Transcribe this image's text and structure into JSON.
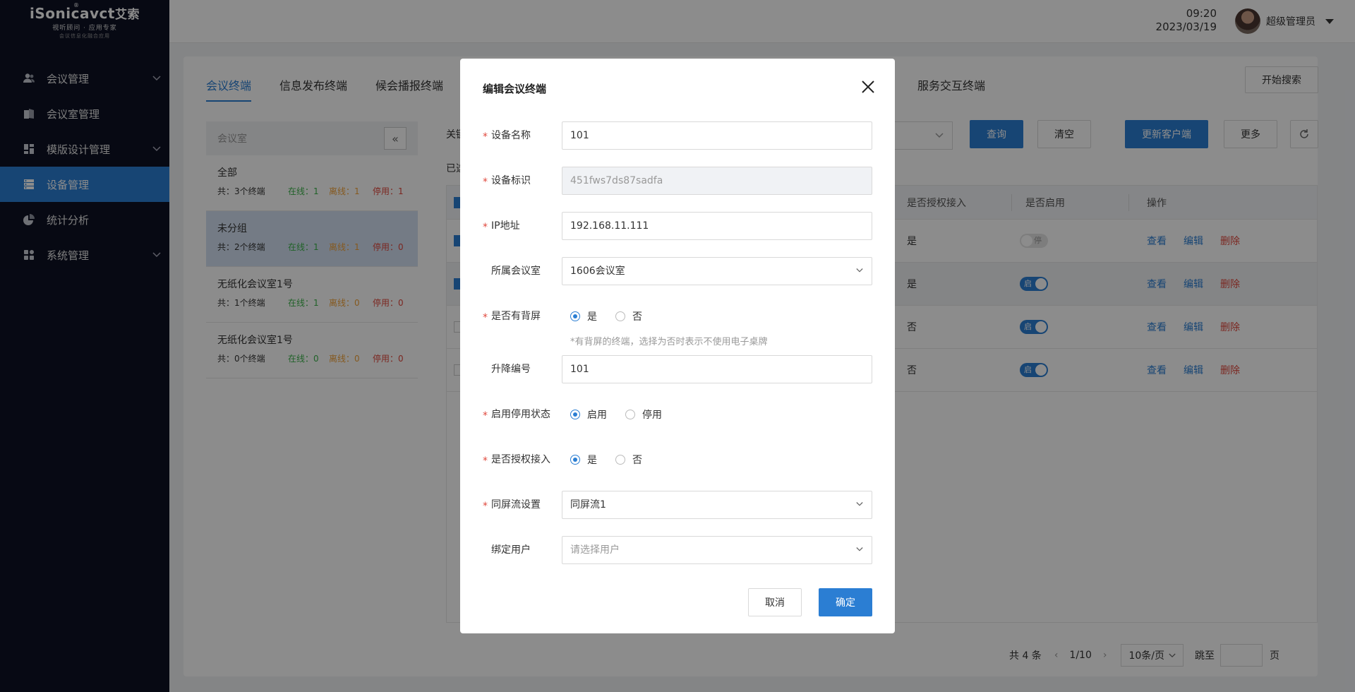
{
  "app": {
    "logo_text": "iSonicavct",
    "logo_cn": "艾索",
    "logo_tagline": "視听顾问 · 应用专家",
    "logo_subtag": "会议信息化融合应用",
    "logo_mark": "®"
  },
  "sidebar": {
    "items": [
      {
        "label": "会议管理",
        "icon": "users-icon",
        "has_arrow": true
      },
      {
        "label": "会议室管理",
        "icon": "door-icon",
        "has_arrow": false
      },
      {
        "label": "模版设计管理",
        "icon": "layout-icon",
        "has_arrow": true
      },
      {
        "label": "设备管理",
        "icon": "server-icon",
        "has_arrow": false,
        "active": true
      },
      {
        "label": "统计分析",
        "icon": "pie-chart-icon",
        "has_arrow": false
      },
      {
        "label": "系统管理",
        "icon": "grid-icon",
        "has_arrow": true
      }
    ]
  },
  "header": {
    "time": "09:20",
    "date": "2023/03/19",
    "user_name": "超级管理员"
  },
  "tabs": [
    {
      "label": "会议终端",
      "active": true
    },
    {
      "label": "信息发布终端"
    },
    {
      "label": "候会播报终端"
    }
  ],
  "tab_service": "服务交互终端",
  "toolbar": {
    "start_search": "开始搜索",
    "keyword_label": "关键",
    "query": "查询",
    "clear": "清空",
    "update_client": "更新客户端",
    "more": "更多",
    "selected_prefix": "已选"
  },
  "room_panel": {
    "header": "会议室",
    "rooms": [
      {
        "name": "全部",
        "total": "共：3个终端",
        "online": "在线：1",
        "offline": "离线：1",
        "stopped": "停用：1"
      },
      {
        "name": "未分组",
        "total": "共：2个终端",
        "online": "在线：1",
        "offline": "离线：1",
        "stopped": "停用：0",
        "selected": true
      },
      {
        "name": "无纸化会议室1号",
        "total": "共：1个终端",
        "online": "在线：1",
        "offline": "离线：0",
        "stopped": "停用：0"
      },
      {
        "name": "无纸化会议室1号",
        "total": "共：0个终端",
        "online": "在线：0",
        "offline": "离线：0",
        "stopped": "停用：0"
      }
    ]
  },
  "table": {
    "headers": {
      "authorized": "是否授权接入",
      "enabled": "是否启用",
      "actions": "操作"
    },
    "rows": [
      {
        "checked": true,
        "authorized": "是",
        "enabled": false,
        "toggle_text": "停",
        "highlight": false
      },
      {
        "checked": true,
        "authorized": "是",
        "enabled": true,
        "toggle_text": "启",
        "highlight": true
      },
      {
        "checked": false,
        "authorized": "否",
        "enabled": true,
        "toggle_text": "启",
        "highlight": false
      },
      {
        "checked": false,
        "authorized": "否",
        "enabled": true,
        "toggle_text": "启",
        "highlight": false
      }
    ],
    "actions": {
      "view": "查看",
      "edit": "编辑",
      "delete": "删除"
    }
  },
  "pagination": {
    "total": "共 4 条",
    "page": "1/10",
    "page_size": "10条/页",
    "jump_label": "跳至",
    "page_suffix": "页"
  },
  "modal": {
    "title": "编辑会议终端",
    "fields": {
      "device_name": {
        "label": "设备名称",
        "value": "101",
        "required": true
      },
      "device_id": {
        "label": "设备标识",
        "value": "451fws7ds87sadfa",
        "required": true
      },
      "ip": {
        "label": "IP地址",
        "value": "192.168.11.111",
        "required": true
      },
      "room": {
        "label": "所属会议室",
        "value": "1606会议室",
        "required": false
      },
      "back_screen": {
        "label": "是否有背屏",
        "required": true,
        "options": [
          "是",
          "否"
        ],
        "selected": 0
      },
      "back_screen_hint": "*有背屏的终端，选择为否时表示不使用电子桌牌",
      "lift_number": {
        "label": "升降编号",
        "value": "101",
        "required": false
      },
      "status": {
        "label": "启用停用状态",
        "required": true,
        "options": [
          "启用",
          "停用"
        ],
        "selected": 0
      },
      "authorized": {
        "label": "是否授权接入",
        "required": true,
        "options": [
          "是",
          "否"
        ],
        "selected": 0
      },
      "stream": {
        "label": "同屏流设置",
        "value": "同屏流1",
        "required": true
      },
      "bind_user": {
        "label": "绑定用户",
        "placeholder": "请选择用户",
        "required": false
      }
    },
    "cancel": "取消",
    "confirm": "确定"
  },
  "colors": {
    "primary": "#2b7ed3",
    "sidebar_bg": "#0d1124",
    "danger": "#e0483d",
    "online": "#3bb34a",
    "offline": "#f2a33a"
  }
}
